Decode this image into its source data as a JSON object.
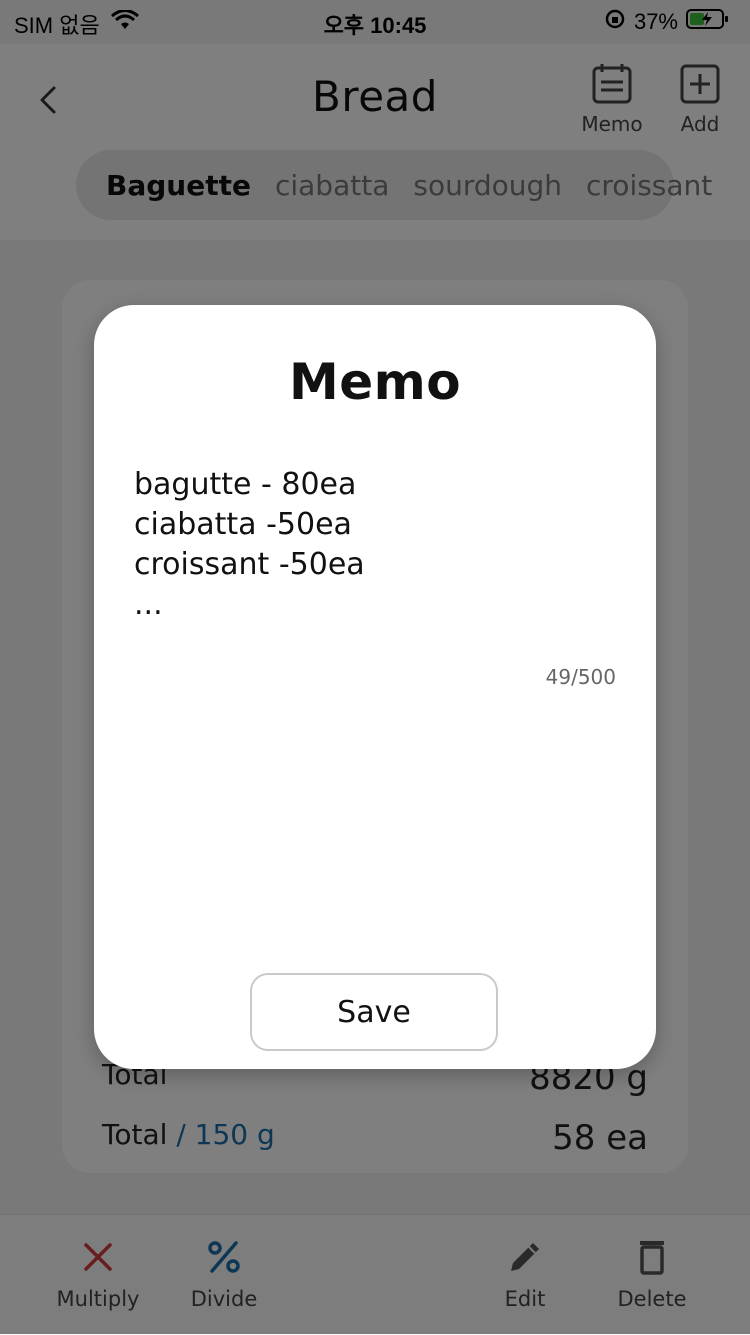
{
  "status_bar": {
    "carrier": "SIM 없음",
    "time": "오후 10:45",
    "battery": "37%"
  },
  "header": {
    "title": "Bread",
    "memo_label": "Memo",
    "add_label": "Add"
  },
  "tabs": [
    {
      "label": "Baguette",
      "active": true
    },
    {
      "label": "ciabatta",
      "active": false
    },
    {
      "label": "sourdough",
      "active": false
    },
    {
      "label": "croissant",
      "active": false
    }
  ],
  "card": {
    "row1_label": "Total",
    "row1_value": "8820 g",
    "row2_label": "Total",
    "row2_accent": "/ 150 g",
    "row2_value": "58 ea"
  },
  "bottom_bar": {
    "multiply": "Multiply",
    "divide": "Divide",
    "edit": "Edit",
    "delete": "Delete"
  },
  "modal": {
    "title": "Memo",
    "text": "bagutte - 80ea\nciabatta -50ea\ncroissant -50ea\n...",
    "char_count": "49/500",
    "save_label": "Save"
  },
  "colors": {
    "accent": "#1a6fa8",
    "multiply_icon": "#d23a3a",
    "overlay": "rgba(0,0,0,0.5)"
  }
}
